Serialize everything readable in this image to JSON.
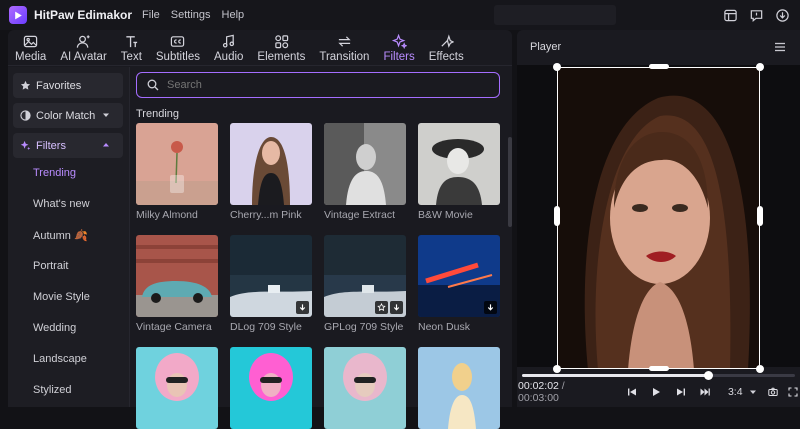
{
  "app": {
    "name": "HitPaw Edimakor",
    "menu": [
      "File",
      "Settings",
      "Help"
    ]
  },
  "toolbar": [
    {
      "label": "Media",
      "icon": "media-icon"
    },
    {
      "label": "AI Avatar",
      "icon": "ai-avatar-icon"
    },
    {
      "label": "Text",
      "icon": "text-icon"
    },
    {
      "label": "Subtitles",
      "icon": "subtitles-icon"
    },
    {
      "label": "Audio",
      "icon": "audio-icon"
    },
    {
      "label": "Elements",
      "icon": "elements-icon"
    },
    {
      "label": "Transition",
      "icon": "transition-icon"
    },
    {
      "label": "Filters",
      "icon": "filters-icon",
      "active": true
    },
    {
      "label": "Effects",
      "icon": "effects-icon"
    }
  ],
  "sidebar": {
    "favorites": "Favorites",
    "color_match": "Color Match",
    "filters": "Filters",
    "items": [
      "Trending",
      "What's new",
      "Autumn 🍂",
      "Portrait",
      "Movie Style",
      "Wedding",
      "Landscape",
      "Stylized"
    ],
    "active_item": "Trending"
  },
  "search": {
    "placeholder": "Search"
  },
  "section_title": "Trending",
  "filters": [
    {
      "name": "Milky Almond",
      "scene": "rose"
    },
    {
      "name": "Cherry...m Pink",
      "scene": "girl-pink"
    },
    {
      "name": "Vintage Extract",
      "scene": "bw-woman"
    },
    {
      "name": "B&W Movie",
      "scene": "bw-hat"
    },
    {
      "name": "Vintage Camera",
      "scene": "car",
      "badges": []
    },
    {
      "name": "DLog 709 Style",
      "scene": "dark-landscape",
      "badges": [
        "download"
      ]
    },
    {
      "name": "GPLog 709 Style",
      "scene": "dark-landscape",
      "badges": [
        "favorite",
        "download"
      ]
    },
    {
      "name": "Neon Dusk",
      "scene": "neon",
      "badges": [
        "download"
      ]
    },
    {
      "name": "",
      "scene": "pink-hair-1"
    },
    {
      "name": "",
      "scene": "pink-hair-2"
    },
    {
      "name": "",
      "scene": "pink-hair-3"
    },
    {
      "name": "",
      "scene": "beach"
    }
  ],
  "player": {
    "title": "Player",
    "current_time": "00:02:02",
    "separator": " / ",
    "duration": "00:03:00",
    "progress": 0.68,
    "aspect_ratio": "3:4"
  },
  "colors": {
    "accent": "#a46dff",
    "bg": "#121216",
    "panel": "#1a1a20"
  }
}
